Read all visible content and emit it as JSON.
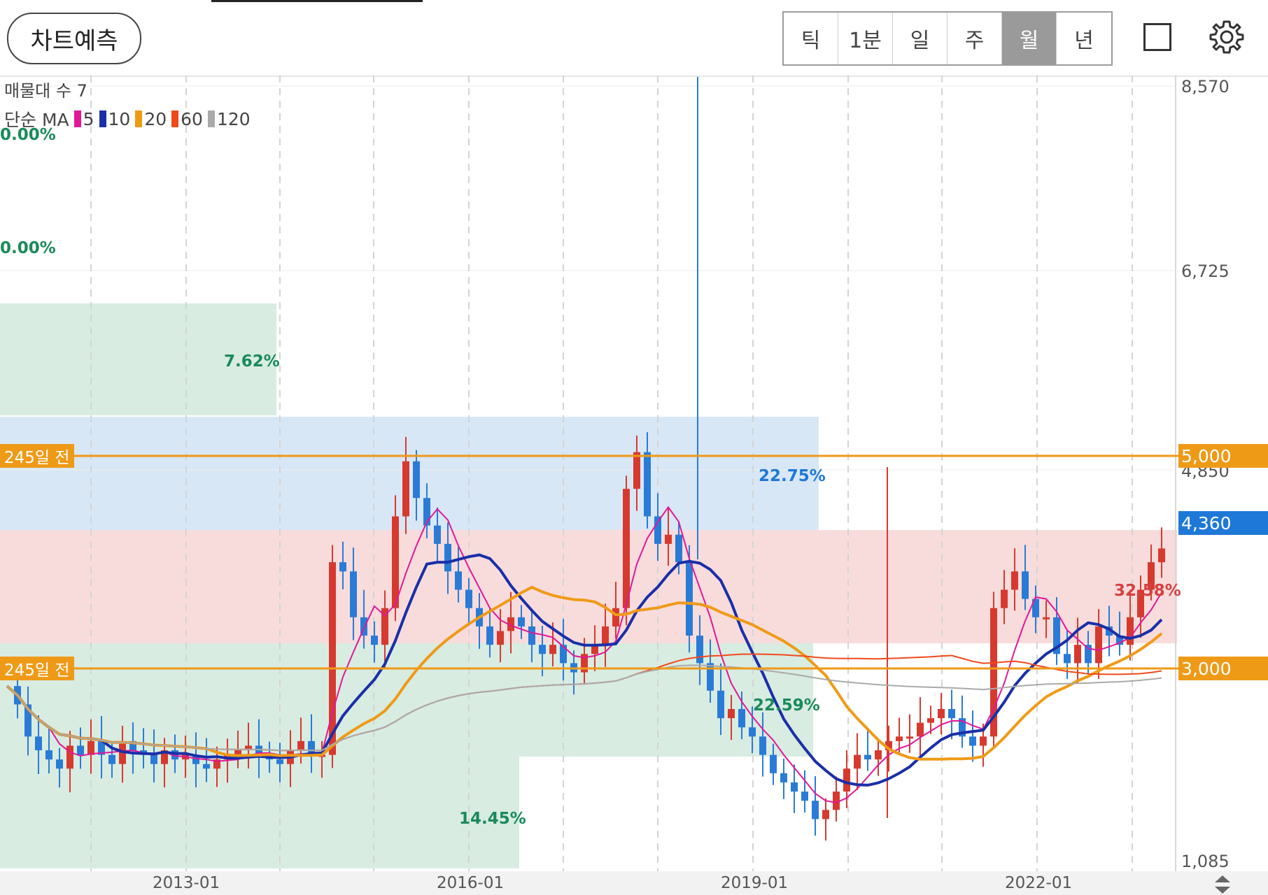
{
  "toolbar": {
    "predict_label": "차트예측",
    "periods": [
      {
        "label": "틱",
        "active": false
      },
      {
        "label": "1분",
        "active": false
      },
      {
        "label": "일",
        "active": false
      },
      {
        "label": "주",
        "active": false
      },
      {
        "label": "월",
        "active": true
      },
      {
        "label": "년",
        "active": false
      }
    ]
  },
  "info": {
    "volume_profile_label": "매물대 수 7",
    "ma_label": "단순 MA",
    "ma_items": [
      {
        "period": "5",
        "color": "#e0189a"
      },
      {
        "period": "10",
        "color": "#1a2fa8"
      },
      {
        "period": "20",
        "color": "#ef9a17"
      },
      {
        "period": "60",
        "color": "#f04a1a"
      },
      {
        "period": "120",
        "color": "#aaaaaa"
      }
    ]
  },
  "y_axis": {
    "ticks": [
      "8,570",
      "6,725",
      "4,850",
      "1,085"
    ]
  },
  "x_axis": {
    "ticks": [
      "2013-01",
      "2016-01",
      "2019-01",
      "2022-01"
    ]
  },
  "price_tags": {
    "upper": "5,000",
    "current": "4,360",
    "lower": "3,000"
  },
  "left_tags": {
    "upper": "245일 전",
    "lower": "245일 전"
  },
  "bands_pct": [
    "0.00%",
    "0.00%",
    "7.62%",
    "22.75%",
    "32.58%",
    "22.59%",
    "14.45%"
  ],
  "colors": {
    "up": "#d63a2f",
    "down": "#2a7bd6",
    "accent": "#ef9a17",
    "current": "#1e78d8"
  },
  "chart_data": {
    "type": "candlestick",
    "x_ticks": [
      "2013-01",
      "2016-01",
      "2019-01",
      "2022-01"
    ],
    "y_ticks": [
      1085,
      4850,
      6725,
      8570
    ],
    "ylim": [
      1085,
      8570
    ],
    "current_price": 4360,
    "horizontal_lines": [
      5000,
      3000
    ],
    "volume_profile": [
      {
        "label": "0.00%"
      },
      {
        "label": "0.00%"
      },
      {
        "label": "7.62%"
      },
      {
        "label": "22.75%"
      },
      {
        "label": "32.58%"
      },
      {
        "label": "22.59%"
      },
      {
        "label": "14.45%"
      }
    ],
    "moving_averages": [
      "5",
      "10",
      "20",
      "60",
      "120"
    ]
  }
}
